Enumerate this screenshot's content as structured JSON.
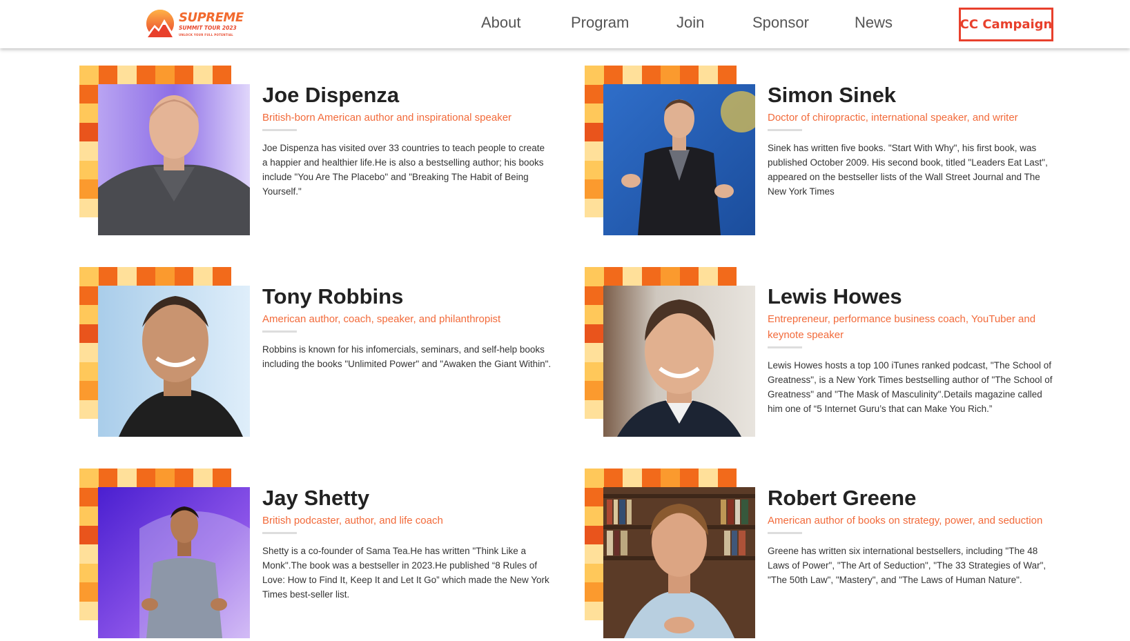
{
  "brand": {
    "logo_title": "SUPREME",
    "logo_subtitle": "SUMMIT TOUR 2023",
    "logo_tagline": "UNLOCK YOUR FULL POTENTIAL"
  },
  "nav": {
    "items": [
      {
        "label": "About"
      },
      {
        "label": "Program"
      },
      {
        "label": "Join"
      },
      {
        "label": "Sponsor"
      },
      {
        "label": "News"
      }
    ],
    "cta_label": "CC Campaign"
  },
  "colors": {
    "accent": "#f26a3a",
    "cta_border": "#e8402c",
    "mosaic": [
      "#f26a1b",
      "#ffc85a",
      "#ffe09a",
      "#fb9a2e",
      "#e9541c"
    ]
  },
  "speakers": [
    {
      "name": "Joe Dispenza",
      "role": "British-born American author and inspirational speaker",
      "bio": "Joe Dispenza has visited over 33 countries to teach people to create a happier and healthier life.He is also a bestselling author; his books include \"You Are The Placebo\" and \"Breaking The Habit of Being Yourself.\""
    },
    {
      "name": "Simon Sinek",
      "role": "Doctor of chiropractic, international speaker, and writer",
      "bio": "Sinek has written five books. \"Start With Why\", his first book, was published October 2009. His second book, titled \"Leaders Eat Last\", appeared on the bestseller lists of the Wall Street Journal and The New York Times"
    },
    {
      "name": "Tony Robbins",
      "role": "American author, coach, speaker, and philanthropist",
      "bio": "Robbins is known for his infomercials, seminars, and self-help books including the books \"Unlimited Power\" and \"Awaken the Giant Within\"."
    },
    {
      "name": "Lewis Howes",
      "role": "Entrepreneur, performance business coach, YouTuber and keynote speaker",
      "bio": "Lewis Howes hosts a top 100 iTunes ranked podcast, \"The School of Greatness\", is a New York Times bestselling author of \"The School of Greatness\" and \"The Mask of Masculinity\".Details magazine called him one of “5 Internet Guru’s that can Make You Rich.”"
    },
    {
      "name": "Jay Shetty",
      "role": "British podcaster, author, and life coach",
      "bio": "Shetty is a co-founder of Sama Tea.He has written \"Think Like a Monk\".The book was a bestseller in 2023.He published “8 Rules of Love: How to Find It, Keep It and Let It Go” which made the New York Times best-seller list."
    },
    {
      "name": "Robert Greene",
      "role": "American author of books on strategy, power, and seduction",
      "bio": "Greene has written six international bestsellers, including \"The 48 Laws of Power\", \"The Art of Seduction\", \"The 33 Strategies of War\", \"The 50th Law\", \"Mastery\", and \"The Laws of Human Nature\"."
    }
  ]
}
